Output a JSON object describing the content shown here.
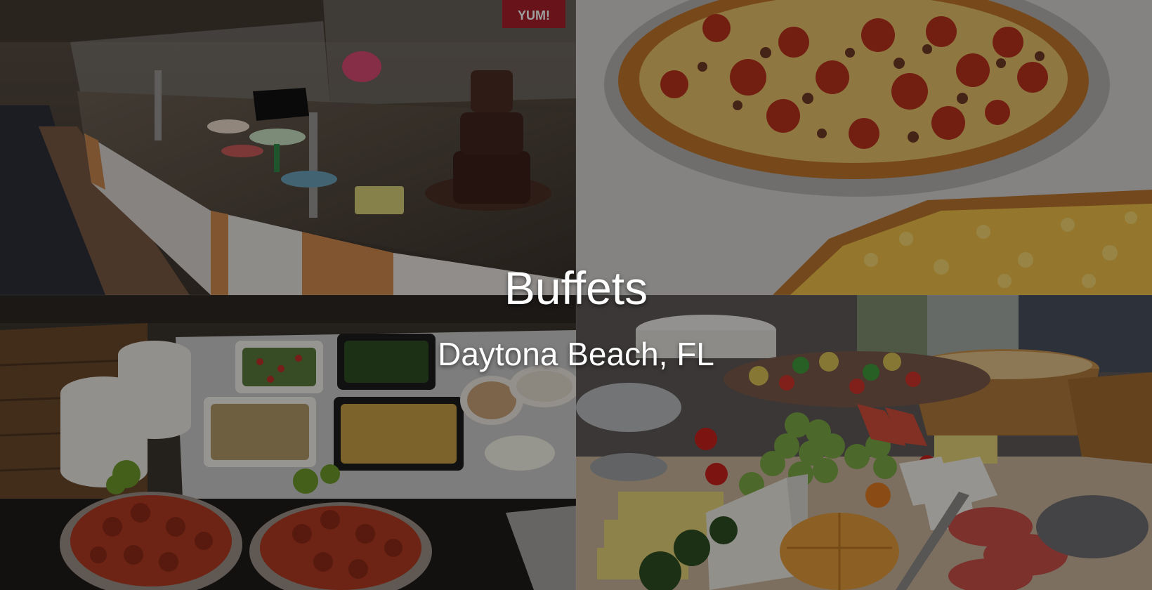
{
  "hero": {
    "title": "Buffets",
    "subtitle": "Daytona Beach, FL"
  },
  "tiles": [
    {
      "name": "tile-dessert-bar",
      "subject": "dessert buffet counter with chocolate fountain",
      "sign_text": "",
      "yum_text": "YUM!"
    },
    {
      "name": "tile-pizza",
      "subject": "pepperoni pizza and mac and cheese pizza"
    },
    {
      "name": "tile-seafood",
      "subject": "crawfish trays, salads and plates"
    },
    {
      "name": "tile-fruit-cheese",
      "subject": "fruit, cheese and bread platter"
    }
  ],
  "colors": {
    "overlay": "rgba(0,0,0,0.38)",
    "text": "#ffffff"
  }
}
